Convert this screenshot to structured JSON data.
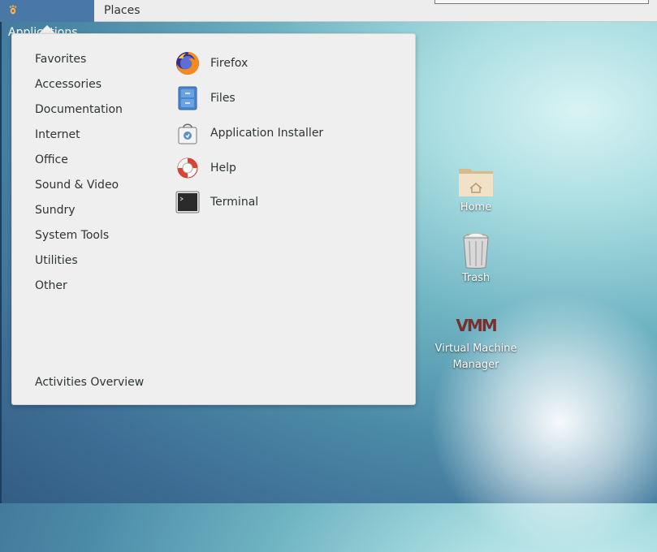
{
  "topbar": {
    "applications_label": "Applications",
    "places_label": "Places"
  },
  "menu": {
    "categories": [
      "Favorites",
      "Accessories",
      "Documentation",
      "Internet",
      "Office",
      "Sound & Video",
      "Sundry",
      "System Tools",
      "Utilities",
      "Other"
    ],
    "activities_label": "Activities Overview",
    "apps": [
      {
        "label": "Firefox",
        "icon": "firefox-icon"
      },
      {
        "label": "Files",
        "icon": "files-icon"
      },
      {
        "label": "Application Installer",
        "icon": "app-installer-icon"
      },
      {
        "label": "Help",
        "icon": "help-icon"
      },
      {
        "label": "Terminal",
        "icon": "terminal-icon"
      }
    ]
  },
  "desktop": {
    "home_label": "Home",
    "trash_label": "Trash",
    "vmm_label_line1": "Virtual Machine",
    "vmm_label_line2": "Manager",
    "vmm_logo_text": "VMM"
  },
  "colors": {
    "topbar_active": "#4a78a6",
    "menu_bg": "#efefef",
    "text": "#2e3436"
  }
}
